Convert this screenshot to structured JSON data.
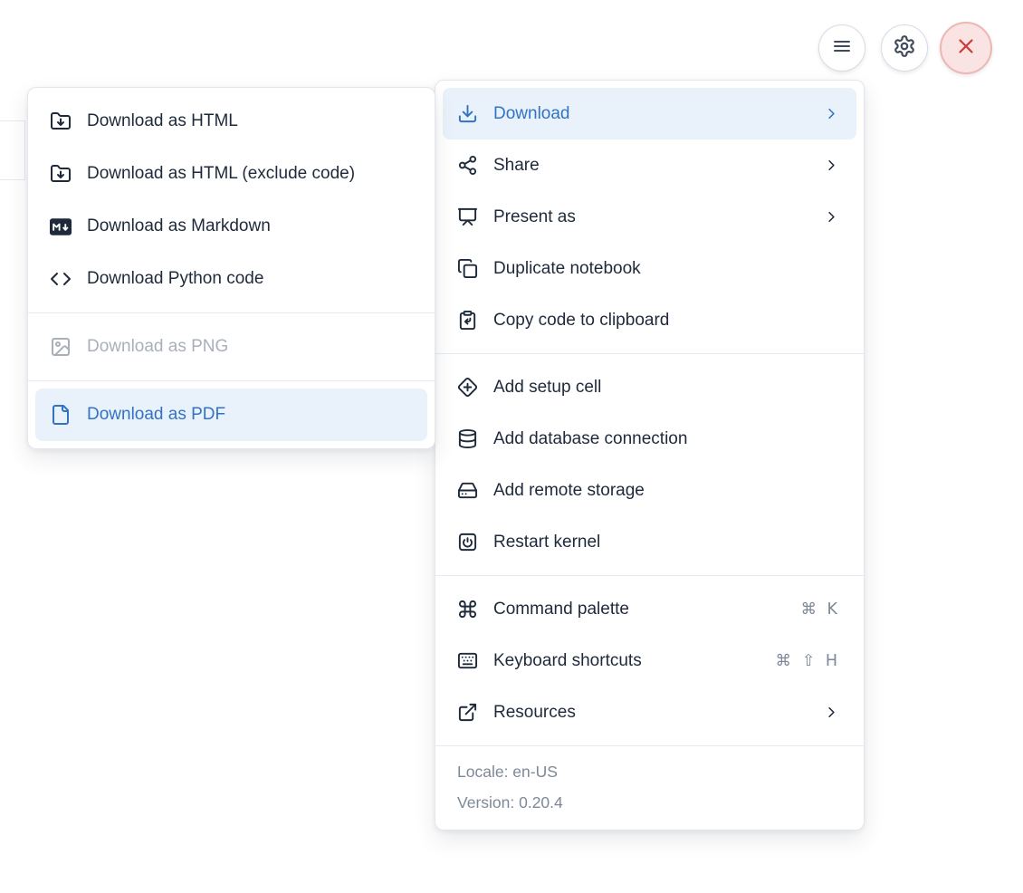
{
  "toolbar": {
    "menu_button_icon": "hamburger",
    "settings_button_icon": "gear",
    "close_button_icon": "x"
  },
  "submenu": {
    "items": [
      {
        "label": "Download as HTML",
        "icon": "folder-down-icon",
        "state": "normal"
      },
      {
        "label": "Download as HTML (exclude code)",
        "icon": "folder-down-icon",
        "state": "normal"
      },
      {
        "label": "Download as Markdown",
        "icon": "markdown-badge-icon",
        "state": "normal"
      },
      {
        "label": "Download Python code",
        "icon": "code-icon",
        "state": "normal"
      },
      {
        "label": "Download as PNG",
        "icon": "image-icon",
        "state": "disabled"
      },
      {
        "label": "Download as PDF",
        "icon": "file-icon",
        "state": "highlighted"
      }
    ]
  },
  "menu": {
    "items": [
      {
        "label": "Download",
        "icon": "download-icon",
        "has_submenu": true,
        "state": "highlighted"
      },
      {
        "label": "Share",
        "icon": "share-icon",
        "has_submenu": true
      },
      {
        "label": "Present as",
        "icon": "presentation-icon",
        "has_submenu": true
      },
      {
        "label": "Duplicate notebook",
        "icon": "copy-icon"
      },
      {
        "label": "Copy code to clipboard",
        "icon": "clipboard-icon"
      },
      {
        "label": "Add setup cell",
        "icon": "diamond-plus-icon"
      },
      {
        "label": "Add database connection",
        "icon": "database-icon"
      },
      {
        "label": "Add remote storage",
        "icon": "hard-drive-icon"
      },
      {
        "label": "Restart kernel",
        "icon": "power-square-icon"
      },
      {
        "label": "Command palette",
        "icon": "command-icon",
        "shortcut": "⌘ K"
      },
      {
        "label": "Keyboard shortcuts",
        "icon": "keyboard-icon",
        "shortcut": "⌘ ⇧ H"
      },
      {
        "label": "Resources",
        "icon": "external-link-icon",
        "has_submenu": true
      }
    ],
    "footer": {
      "locale": "Locale: en-US",
      "version": "Version: 0.20.4"
    }
  },
  "colors": {
    "accent_blue": "#3273c5",
    "highlight_bg": "#e9f1fb",
    "text": "#1e2a3b",
    "muted": "#7e8899",
    "disabled": "#a9b0ba",
    "danger_red": "#cc3b35",
    "danger_bg": "#f9e3e3"
  }
}
